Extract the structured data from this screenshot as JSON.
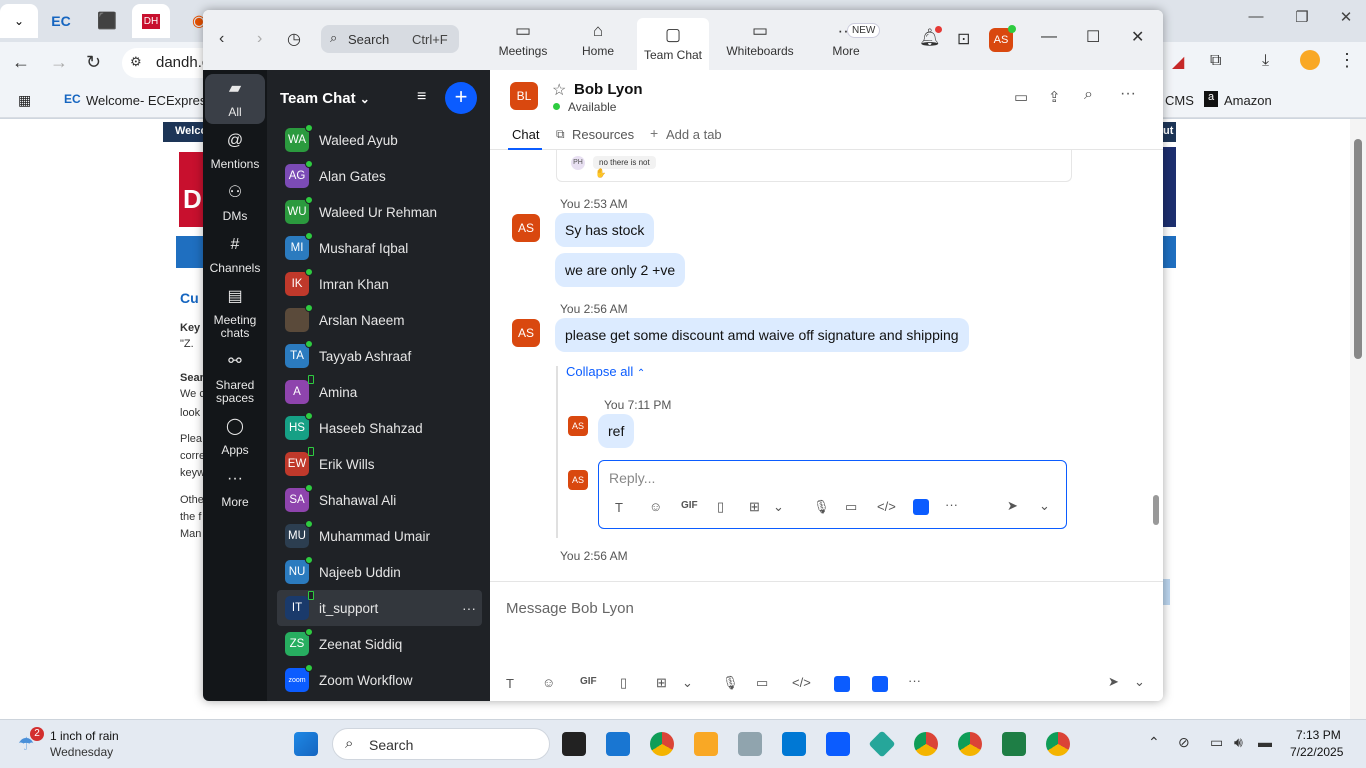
{
  "browser": {
    "url_text": "dandh.c",
    "bookmarks": [
      "Welcome- ECExpres...",
      "CMS",
      "Amazon"
    ]
  },
  "website": {
    "lines": [
      "Welco",
      "Cu",
      "Key",
      "\"Z.",
      "Sear",
      "We c",
      "look",
      "Plea",
      "corre",
      "keyw",
      "Othe",
      "the f",
      "Man",
      "D",
      "ut"
    ]
  },
  "zoom": {
    "search": {
      "label": "Search",
      "shortcut": "Ctrl+F"
    },
    "nav": [
      {
        "label": "Meetings"
      },
      {
        "label": "Home"
      },
      {
        "label": "Team Chat"
      },
      {
        "label": "Whiteboards"
      },
      {
        "label": "More",
        "badge": "NEW"
      }
    ],
    "user_initials": "AS",
    "rail": [
      {
        "label": "All"
      },
      {
        "label": "Mentions"
      },
      {
        "label": "DMs"
      },
      {
        "label": "Channels"
      },
      {
        "label": "Meeting chats"
      },
      {
        "label": "Shared spaces"
      },
      {
        "label": "Apps"
      },
      {
        "label": "More"
      }
    ],
    "list_title": "Team Chat",
    "contacts": [
      {
        "initials": "WA",
        "name": "Waleed Ayub",
        "color": "#2b9a3e"
      },
      {
        "initials": "AG",
        "name": "Alan Gates",
        "color": "#7b4bb5"
      },
      {
        "initials": "WU",
        "name": "Waleed Ur Rehman",
        "color": "#2b9a3e"
      },
      {
        "initials": "MI",
        "name": "Musharaf Iqbal",
        "color": "#2b7bbf"
      },
      {
        "initials": "IK",
        "name": "Imran Khan",
        "color": "#c0392b"
      },
      {
        "initials": "",
        "name": "Arslan Naeem",
        "color": "#5a4a3a"
      },
      {
        "initials": "TA",
        "name": "Tayyab Ashraaf",
        "color": "#2b7bbf"
      },
      {
        "initials": "A",
        "name": "Amina",
        "color": "#8e44ad"
      },
      {
        "initials": "HS",
        "name": "Haseeb Shahzad",
        "color": "#16a085"
      },
      {
        "initials": "EW",
        "name": "Erik Wills",
        "color": "#c0392b"
      },
      {
        "initials": "SA",
        "name": "Shahawal Ali",
        "color": "#8e44ad"
      },
      {
        "initials": "MU",
        "name": "Muhammad Umair",
        "color": "#2c3e50"
      },
      {
        "initials": "NU",
        "name": "Najeeb Uddin",
        "color": "#2b7bbf"
      },
      {
        "initials": "IT",
        "name": "it_support",
        "color": "#1a3a6b"
      },
      {
        "initials": "ZS",
        "name": "Zeenat Siddiq",
        "color": "#27ae60"
      },
      {
        "initials": "zoom",
        "name": "Zoom Workflow",
        "color": "#0b5cff"
      }
    ],
    "chat": {
      "contact_initials": "BL",
      "contact_name": "Bob Lyon",
      "status": "Available",
      "tabs": [
        "Chat",
        "Resources",
        "Add a tab"
      ],
      "preview": {
        "initials": "PH",
        "text": "no there is not"
      },
      "messages": [
        {
          "sender": "You",
          "time": "2:53 AM",
          "initials": "AS",
          "texts": [
            "Sy has stock",
            "we are only 2 +ve"
          ]
        },
        {
          "sender": "You",
          "time": "2:56 AM",
          "initials": "AS",
          "texts": [
            "please get some discount amd waive off signature and shipping"
          ]
        }
      ],
      "collapse_label": "Collapse all",
      "reply": {
        "sender": "You",
        "time": "7:11 PM",
        "initials": "AS",
        "text": "ref"
      },
      "reply_placeholder": "Reply...",
      "next_meta": {
        "sender": "You",
        "time": "2:56 AM"
      },
      "composer_placeholder": "Message Bob Lyon"
    }
  },
  "taskbar": {
    "weather_title": "1 inch of rain",
    "weather_day": "Wednesday",
    "weather_badge": "2",
    "search": "Search",
    "time": "7:13 PM",
    "date": "7/22/2025"
  }
}
